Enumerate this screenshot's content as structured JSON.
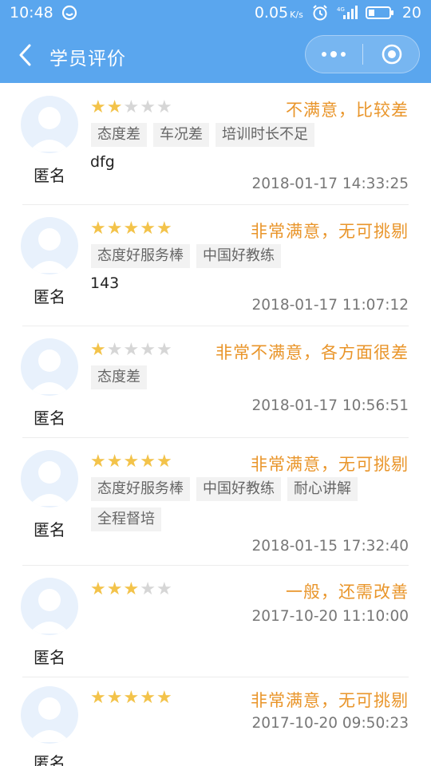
{
  "status_bar": {
    "time": "10:48",
    "speed": "0.05",
    "speed_unit": "K/s",
    "battery": "20"
  },
  "nav": {
    "title": "学员评价"
  },
  "reviews": [
    {
      "name": "匿名",
      "rating": 2,
      "verdict": "不满意，比较差",
      "tags": [
        "态度差",
        "车况差",
        "培训时长不足"
      ],
      "comment": "dfg",
      "time": "2018-01-17 14:33:25"
    },
    {
      "name": "匿名",
      "rating": 5,
      "verdict": "非常满意，无可挑剔",
      "tags": [
        "态度好服务棒",
        "中国好教练"
      ],
      "comment": "143",
      "time": "2018-01-17 11:07:12"
    },
    {
      "name": "匿名",
      "rating": 1,
      "verdict": "非常不满意，各方面很差",
      "tags": [
        "态度差"
      ],
      "comment": "",
      "time": "2018-01-17 10:56:51"
    },
    {
      "name": "匿名",
      "rating": 5,
      "verdict": "非常满意，无可挑剔",
      "tags": [
        "态度好服务棒",
        "中国好教练",
        "耐心讲解",
        "全程督培"
      ],
      "comment": "",
      "time": "2018-01-15 17:32:40"
    },
    {
      "name": "匿名",
      "rating": 3,
      "verdict": "一般，还需改善",
      "tags": [],
      "comment": "",
      "time": "2017-10-20 11:10:00"
    },
    {
      "name": "匿名",
      "rating": 5,
      "verdict": "非常满意，无可挑剔",
      "tags": [],
      "comment": "",
      "time": "2017-10-20 09:50:23"
    }
  ],
  "colors": {
    "header": "#5aa6ee",
    "star_on": "#f3c34a",
    "star_off": "#d6d6d6",
    "verdict": "#e9952a"
  }
}
